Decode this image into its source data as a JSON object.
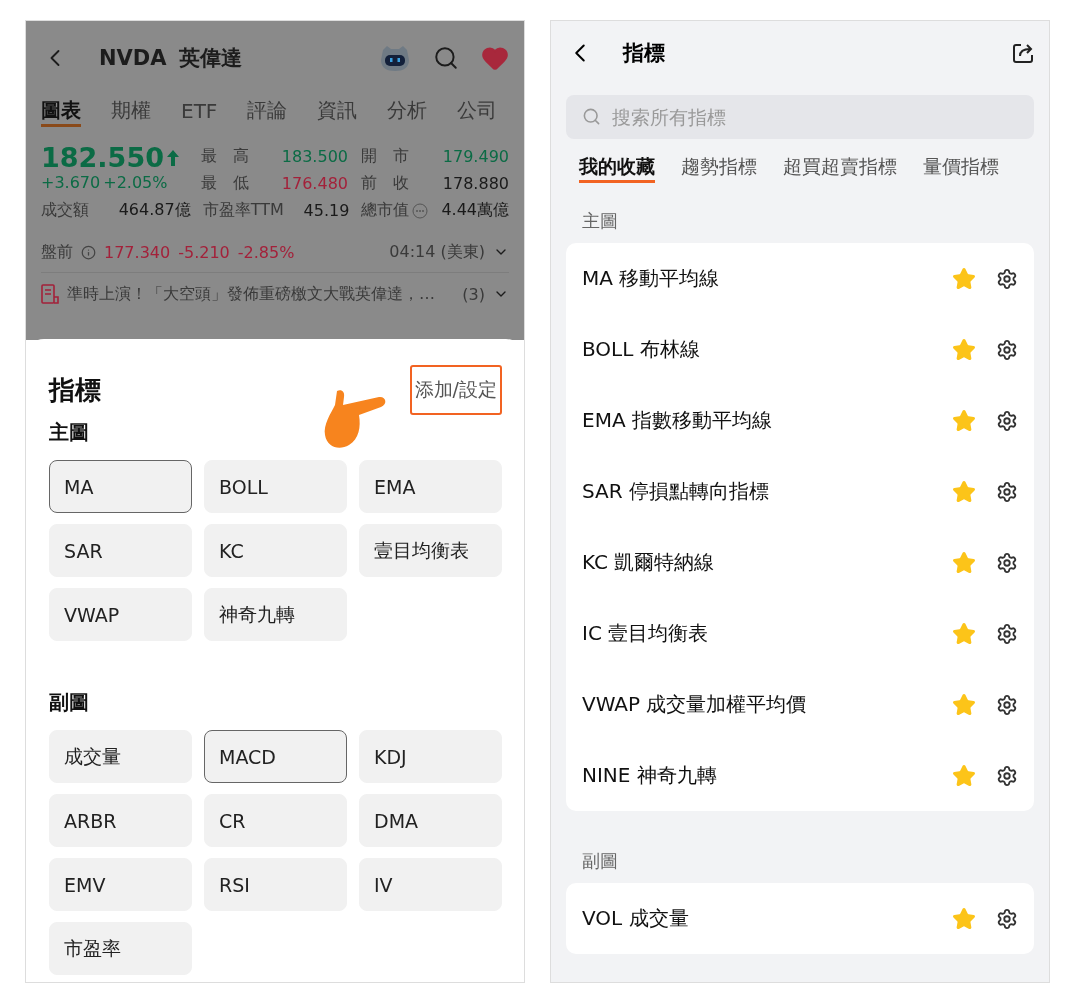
{
  "left": {
    "header": {
      "symbol": "NVDA",
      "name": "英偉達"
    },
    "tabs": [
      {
        "label": "圖表",
        "selected": true
      },
      {
        "label": "期權",
        "selected": false
      },
      {
        "label": "ETF",
        "selected": false
      },
      {
        "label": "評論",
        "selected": false
      },
      {
        "label": "資訊",
        "selected": false
      },
      {
        "label": "分析",
        "selected": false
      },
      {
        "label": "公司",
        "selected": false
      }
    ],
    "quote": {
      "price": "182.550",
      "change": "+3.670",
      "percent": "+2.05%"
    },
    "stats": [
      {
        "label": "最　高",
        "value": "183.500",
        "color": "#0b6b45"
      },
      {
        "label": "開　市",
        "value": "179.490",
        "color": "#0b6b45"
      },
      {
        "label": "最　低",
        "value": "176.480",
        "color": "#a3213a"
      },
      {
        "label": "前　收",
        "value": "178.880",
        "color": "#1a1a1a"
      },
      {
        "label": "成交額",
        "value": "464.87億",
        "color": "#1a1a1a"
      },
      {
        "label": "市盈率TTM",
        "value": "45.19",
        "color": "#1a1a1a"
      },
      {
        "label": "總市值",
        "value": "4.44萬億",
        "color": "#1a1a1a",
        "info": true
      }
    ],
    "premarket": {
      "label": "盤前",
      "price": "177.340",
      "change": "-5.210",
      "percent": "-2.85%",
      "time": "04:14 (美東)"
    },
    "news": {
      "text": "準時上演！「大空頭」發佈重磅檄文大戰英偉達，…",
      "count": "(3)"
    },
    "sheet": {
      "title": "指標",
      "action": "添加/設定",
      "sections": [
        {
          "title": "主圖",
          "chips": [
            {
              "label": "MA",
              "selected": true
            },
            {
              "label": "BOLL",
              "selected": false
            },
            {
              "label": "EMA",
              "selected": false
            },
            {
              "label": "SAR",
              "selected": false
            },
            {
              "label": "KC",
              "selected": false
            },
            {
              "label": "壹目均衡表",
              "selected": false
            },
            {
              "label": "VWAP",
              "selected": false
            },
            {
              "label": "神奇九轉",
              "selected": false
            }
          ]
        },
        {
          "title": "副圖",
          "chips": [
            {
              "label": "成交量",
              "selected": false
            },
            {
              "label": "MACD",
              "selected": true
            },
            {
              "label": "KDJ",
              "selected": false
            },
            {
              "label": "ARBR",
              "selected": false
            },
            {
              "label": "CR",
              "selected": false
            },
            {
              "label": "DMA",
              "selected": false
            },
            {
              "label": "EMV",
              "selected": false
            },
            {
              "label": "RSI",
              "selected": false
            },
            {
              "label": "IV",
              "selected": false
            },
            {
              "label": "市盈率",
              "selected": false
            }
          ]
        }
      ]
    }
  },
  "right": {
    "title": "指標",
    "search": {
      "placeholder": "搜索所有指標"
    },
    "tabs": [
      {
        "label": "我的收藏",
        "selected": true
      },
      {
        "label": "趨勢指標",
        "selected": false
      },
      {
        "label": "超買超賣指標",
        "selected": false
      },
      {
        "label": "量價指標",
        "selected": false
      }
    ],
    "sections": [
      {
        "title": "主圖",
        "items": [
          {
            "label": "MA 移動平均線",
            "favorite": true
          },
          {
            "label": "BOLL 布林線",
            "favorite": true
          },
          {
            "label": "EMA 指數移動平均線",
            "favorite": true
          },
          {
            "label": "SAR 停損點轉向指標",
            "favorite": true
          },
          {
            "label": "KC 凱爾特納線",
            "favorite": true
          },
          {
            "label": "IC 壹目均衡表",
            "favorite": true
          },
          {
            "label": "VWAP 成交量加權平均價",
            "favorite": true
          },
          {
            "label": "NINE 神奇九轉",
            "favorite": true
          }
        ]
      },
      {
        "title": "副圖",
        "items": [
          {
            "label": "VOL 成交量",
            "favorite": true
          }
        ]
      }
    ]
  }
}
